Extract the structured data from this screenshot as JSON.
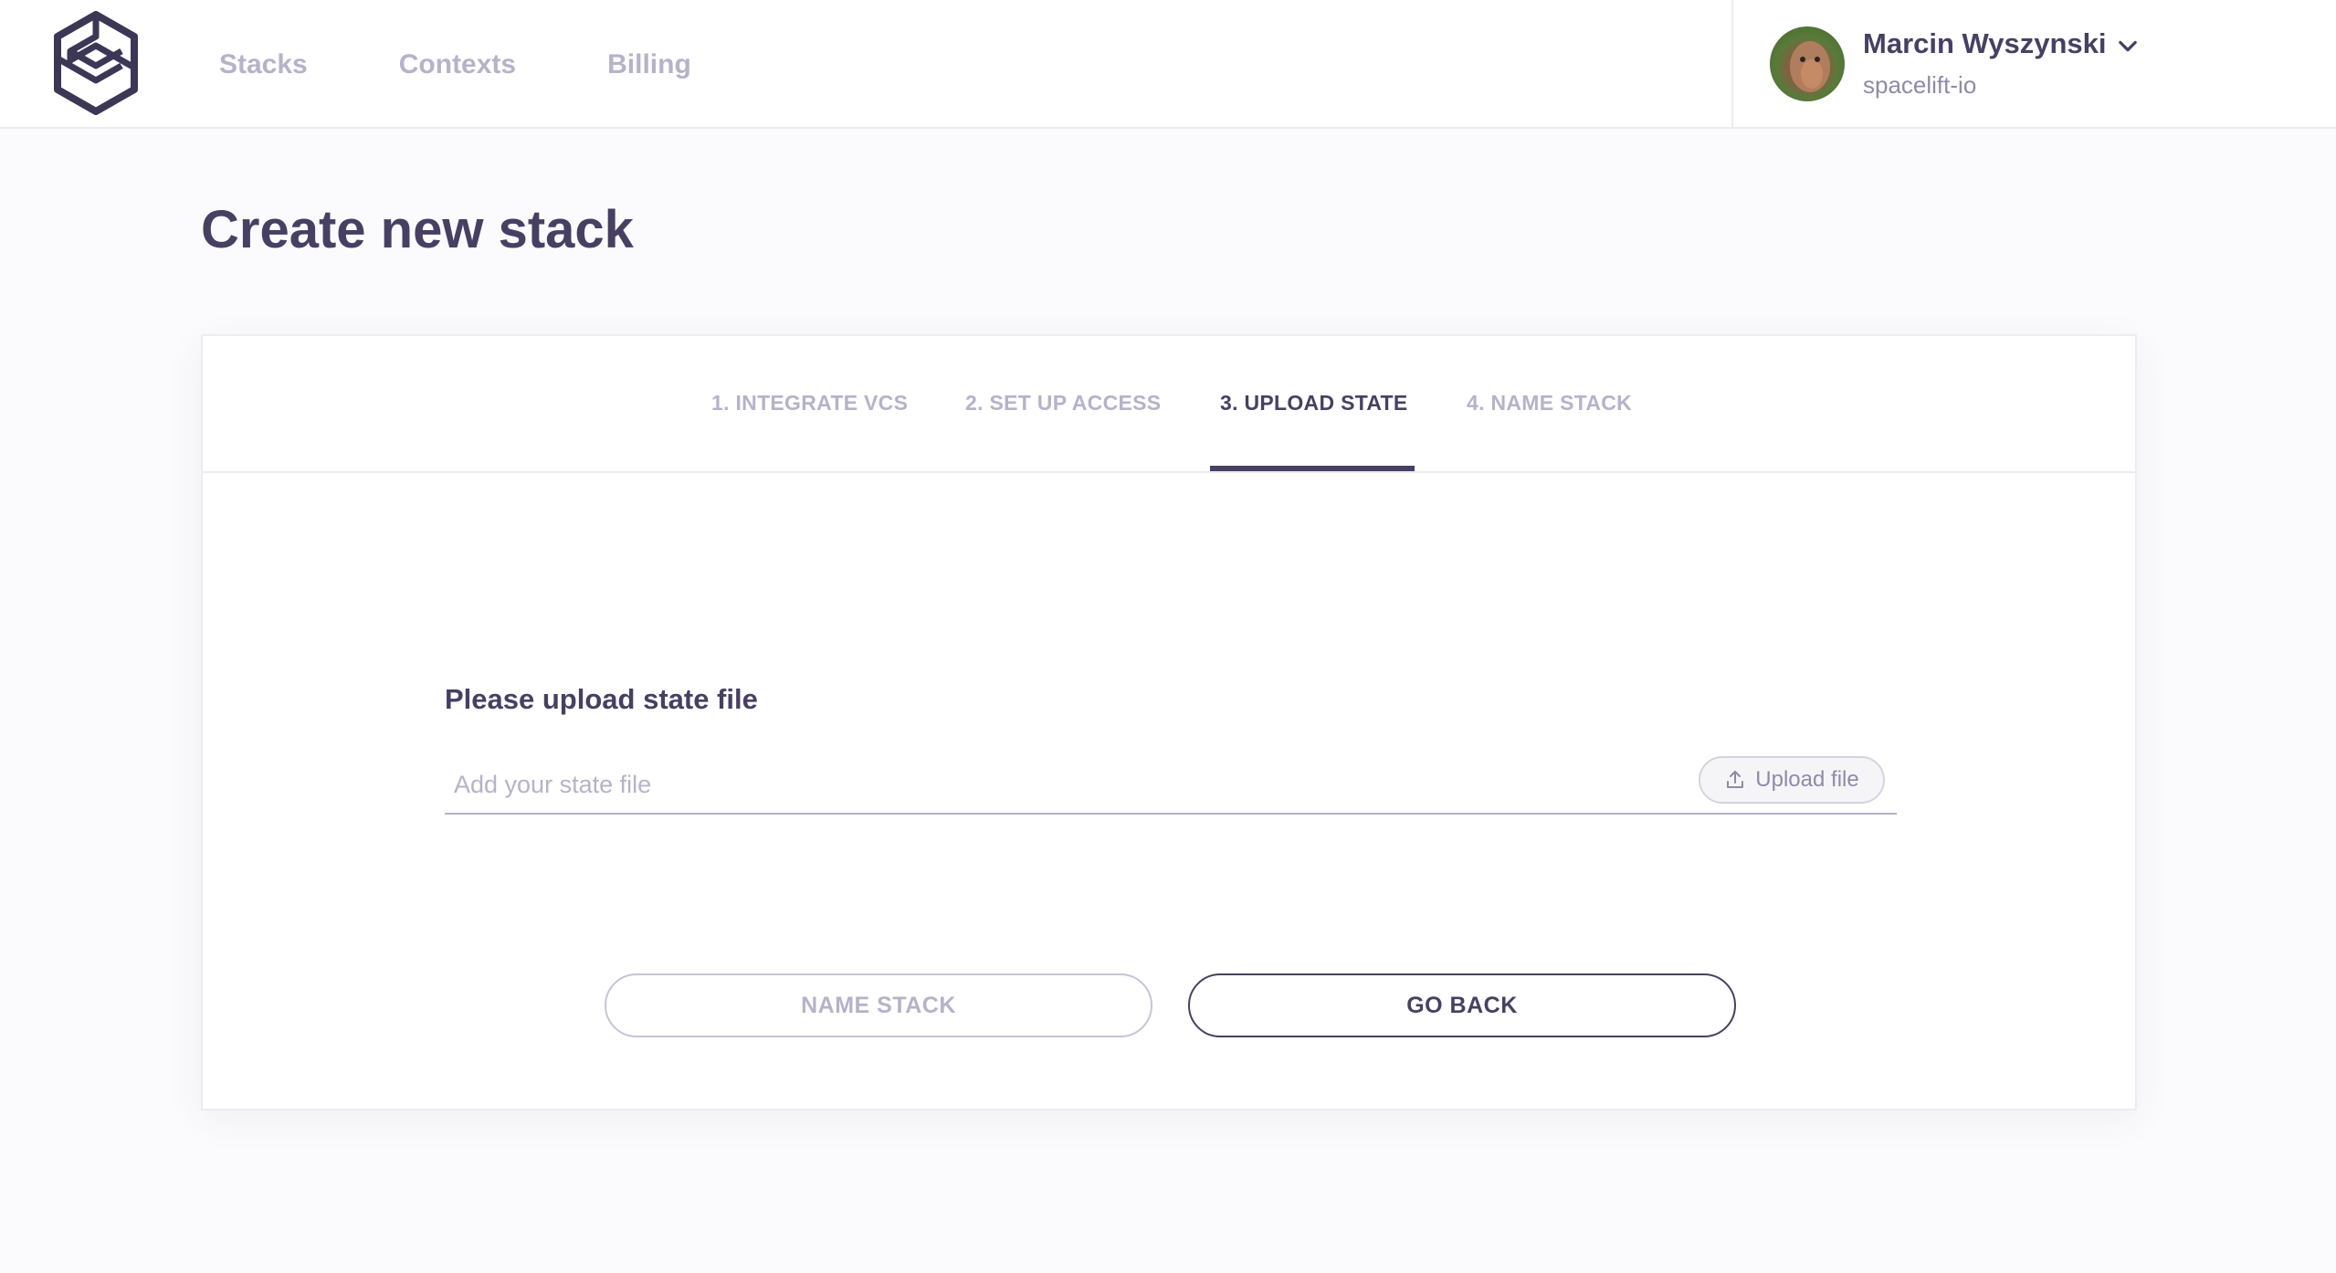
{
  "header": {
    "nav": [
      "Stacks",
      "Contexts",
      "Billing"
    ],
    "user": {
      "name": "Marcin Wyszynski",
      "org": "spacelift-io"
    }
  },
  "page": {
    "title": "Create new stack"
  },
  "steps": [
    {
      "label": "1. INTEGRATE VCS",
      "state": "inactive"
    },
    {
      "label": "2. SET UP ACCESS",
      "state": "inactive"
    },
    {
      "label": "3. UPLOAD STATE",
      "state": "active"
    },
    {
      "label": "4. NAME STACK",
      "state": "inactive"
    }
  ],
  "form": {
    "label": "Please upload state file",
    "placeholder": "Add your state file",
    "upload_label": "Upload file"
  },
  "actions": {
    "next_label": "NAME STACK",
    "next_enabled": false,
    "back_label": "GO BACK"
  },
  "colors": {
    "primary": "#474063",
    "muted": "#b6b2c9",
    "background": "#fbfbfd"
  }
}
